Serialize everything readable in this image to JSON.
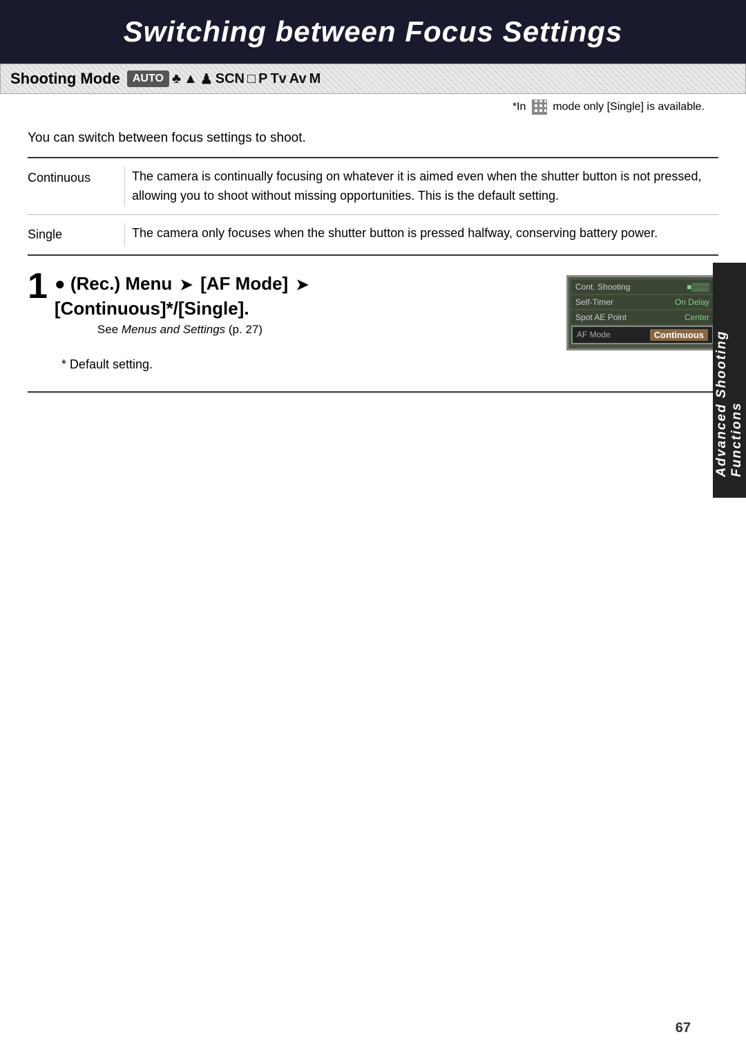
{
  "title": "Switching between Focus Settings",
  "shootingMode": {
    "label": "Shooting Mode",
    "icons": [
      "AUTO",
      "🌸",
      "🏔",
      "👤",
      "SCN",
      "□",
      "P",
      "Tv",
      "Av",
      "M"
    ]
  },
  "noteMode": "*In",
  "noteText": "mode only [Single] is available.",
  "introText": "You can switch between focus settings to shoot.",
  "table": {
    "rows": [
      {
        "term": "Continuous",
        "definition": "The camera is continually focusing on whatever it is aimed even when the shutter button is not pressed, allowing you to shoot without missing opportunities. This is the default setting."
      },
      {
        "term": "Single",
        "definition": "The camera only focuses when the shutter button is pressed halfway, conserving battery power."
      }
    ]
  },
  "step": {
    "number": "1",
    "cameraIcon": "🎥",
    "title": "(Rec.) Menu",
    "arrow1": "➔",
    "afMode": "[AF Mode]",
    "arrow2": "➔",
    "subtitle": "[Continuous]*/[Single].",
    "seeAlso": "See Menus and Settings (p. 27)",
    "defaultNote": "* Default setting."
  },
  "cameraScreen": {
    "rows": [
      {
        "label": "Cont. Shooting",
        "value": "□ ▓▓▓▓"
      },
      {
        "label": "Self-Timer",
        "value": "On Delay"
      },
      {
        "label": "Spot AE Point",
        "value": "Center"
      },
      {
        "label": "AF Mode",
        "value": "Continuous",
        "highlight": true
      }
    ]
  },
  "sideTab": "Advanced Shooting Functions",
  "pageNumber": "67"
}
